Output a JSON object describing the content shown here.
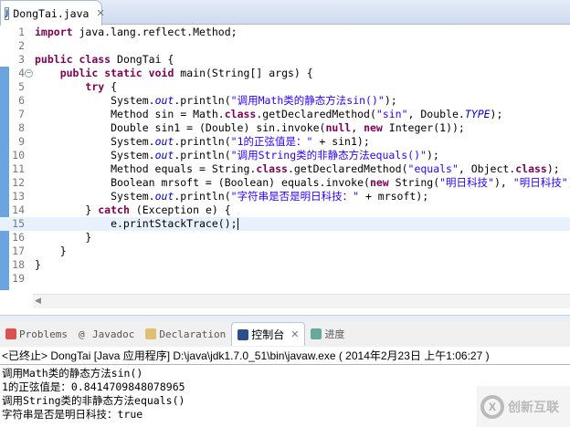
{
  "editor_tab": {
    "title": "DongTai.java",
    "icon": "java-file-icon"
  },
  "code": [
    [
      [
        "import",
        "kw"
      ],
      [
        " java.lang.reflect.Method;",
        ""
      ]
    ],
    [],
    [
      [
        "public",
        "kw"
      ],
      [
        " ",
        ""
      ],
      [
        "class",
        "kw"
      ],
      [
        " DongTai {",
        ""
      ]
    ],
    [
      [
        "    ",
        ""
      ],
      [
        "public",
        "kw"
      ],
      [
        " ",
        ""
      ],
      [
        "static",
        "kw"
      ],
      [
        " ",
        ""
      ],
      [
        "void",
        "kw"
      ],
      [
        " main(String[] args) {",
        ""
      ]
    ],
    [
      [
        "        ",
        ""
      ],
      [
        "try",
        "kw"
      ],
      [
        " {",
        ""
      ]
    ],
    [
      [
        "            System.",
        ""
      ],
      [
        "out",
        "it"
      ],
      [
        ".println(",
        ""
      ],
      [
        "\"调用Math类的静态方法sin()\"",
        "st"
      ],
      [
        ");",
        ""
      ]
    ],
    [
      [
        "            Method sin = Math.",
        ""
      ],
      [
        "class",
        "kw"
      ],
      [
        ".getDeclaredMethod(",
        ""
      ],
      [
        "\"sin\"",
        "st"
      ],
      [
        ", Double.",
        ""
      ],
      [
        "TYPE",
        "it"
      ],
      [
        ");",
        ""
      ]
    ],
    [
      [
        "            Double sin1 = (Double) sin.invoke(",
        ""
      ],
      [
        "null",
        "kw"
      ],
      [
        ", ",
        ""
      ],
      [
        "new",
        "kw"
      ],
      [
        " Integer(1));",
        ""
      ]
    ],
    [
      [
        "            System.",
        ""
      ],
      [
        "out",
        "it"
      ],
      [
        ".println(",
        ""
      ],
      [
        "\"1的正弦值是：\"",
        "st"
      ],
      [
        " + sin1);",
        ""
      ]
    ],
    [
      [
        "            System.",
        ""
      ],
      [
        "out",
        "it"
      ],
      [
        ".println(",
        ""
      ],
      [
        "\"调用String类的非静态方法equals()\"",
        "st"
      ],
      [
        ");",
        ""
      ]
    ],
    [
      [
        "            Method equals = String.",
        ""
      ],
      [
        "class",
        "kw"
      ],
      [
        ".getDeclaredMethod(",
        ""
      ],
      [
        "\"equals\"",
        "st"
      ],
      [
        ", Object.",
        ""
      ],
      [
        "class",
        "kw"
      ],
      [
        ");",
        ""
      ]
    ],
    [
      [
        "            Boolean mrsoft = (Boolean) equals.invoke(",
        ""
      ],
      [
        "new",
        "kw"
      ],
      [
        " String(",
        ""
      ],
      [
        "\"明日科技\"",
        "st"
      ],
      [
        "), ",
        ""
      ],
      [
        "\"明日科技\"",
        "st"
      ],
      [
        ");",
        ""
      ]
    ],
    [
      [
        "            System.",
        ""
      ],
      [
        "out",
        "it"
      ],
      [
        ".println(",
        ""
      ],
      [
        "\"字符串是否是明日科技：\"",
        "st"
      ],
      [
        " + mrsoft);",
        ""
      ]
    ],
    [
      [
        "        } ",
        ""
      ],
      [
        "catch",
        "kw"
      ],
      [
        " (Exception e) {",
        ""
      ]
    ],
    [
      [
        "            e.printStackTrace();",
        ""
      ]
    ],
    [
      [
        "        }",
        ""
      ]
    ],
    [
      [
        "    }",
        ""
      ]
    ],
    [
      [
        "}",
        ""
      ]
    ],
    []
  ],
  "current_line": 15,
  "panel_tabs": [
    {
      "label": "Problems",
      "icon": "problems-icon"
    },
    {
      "label": "Javadoc",
      "icon": "at-icon"
    },
    {
      "label": "Declaration",
      "icon": "declaration-icon"
    },
    {
      "label": "控制台",
      "icon": "console-icon",
      "active": true
    },
    {
      "label": "进度",
      "icon": "progress-icon"
    }
  ],
  "console_header": "<已终止> DongTai [Java 应用程序] D:\\java\\jdk1.7.0_51\\bin\\javaw.exe ( 2014年2月23日 上午1:06:27 )",
  "console_output": [
    "调用Math类的静态方法sin()",
    "1的正弦值是：0.8414709848078965",
    "调用String类的非静态方法equals()",
    "字符串是否是明日科技：true"
  ],
  "watermark": "创新互联"
}
